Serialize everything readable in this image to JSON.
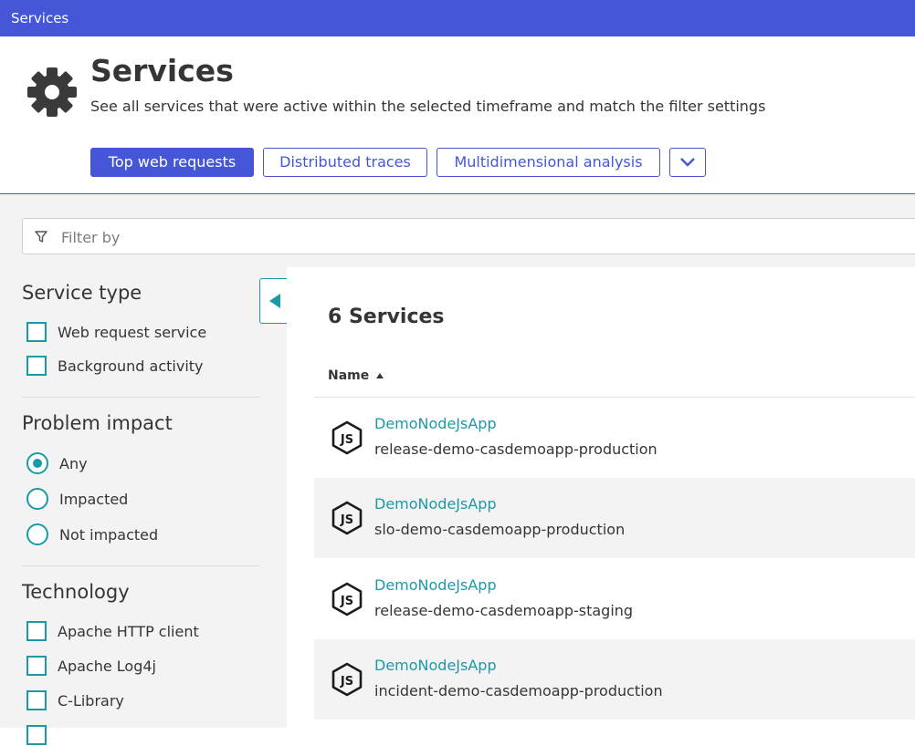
{
  "window": {
    "title": "Services"
  },
  "header": {
    "title": "Services",
    "subtitle": "See all services that were active within the selected timeframe and match the filter settings",
    "icon": "gear-icon",
    "actions": [
      {
        "label": "Top web requests",
        "primary": true
      },
      {
        "label": "Distributed traces",
        "primary": false
      },
      {
        "label": "Multidimensional analysis",
        "primary": false
      }
    ],
    "more_icon": "chevron-down-icon"
  },
  "filter": {
    "placeholder": "Filter by",
    "value": "",
    "icon": "filter-icon"
  },
  "sidebar": {
    "service_type": {
      "title": "Service type",
      "options": [
        {
          "label": "Web request service",
          "checked": false
        },
        {
          "label": "Background activity",
          "checked": false
        }
      ]
    },
    "problem_impact": {
      "title": "Problem impact",
      "options": [
        {
          "label": "Any",
          "selected": true
        },
        {
          "label": "Impacted",
          "selected": false
        },
        {
          "label": "Not impacted",
          "selected": false
        }
      ]
    },
    "technology": {
      "title": "Technology",
      "options": [
        {
          "label": "Apache HTTP client",
          "checked": false
        },
        {
          "label": "Apache Log4j",
          "checked": false
        },
        {
          "label": "C-Library",
          "checked": false
        }
      ]
    }
  },
  "main": {
    "count_title": "6 Services",
    "column_header": "Name",
    "sort": "ascending",
    "services": [
      {
        "name": "DemoNodeJsApp",
        "subtitle": "release-demo-casdemoapp-production",
        "icon": "nodejs-icon"
      },
      {
        "name": "DemoNodeJsApp",
        "subtitle": "slo-demo-casdemoapp-production",
        "icon": "nodejs-icon"
      },
      {
        "name": "DemoNodeJsApp",
        "subtitle": "release-demo-casdemoapp-staging",
        "icon": "nodejs-icon"
      },
      {
        "name": "DemoNodeJsApp",
        "subtitle": "incident-demo-casdemoapp-production",
        "icon": "nodejs-icon"
      }
    ]
  },
  "colors": {
    "brand": "#4556d8",
    "accent": "#1a9aa8",
    "text": "#353535",
    "background": "#f3f3f3"
  }
}
